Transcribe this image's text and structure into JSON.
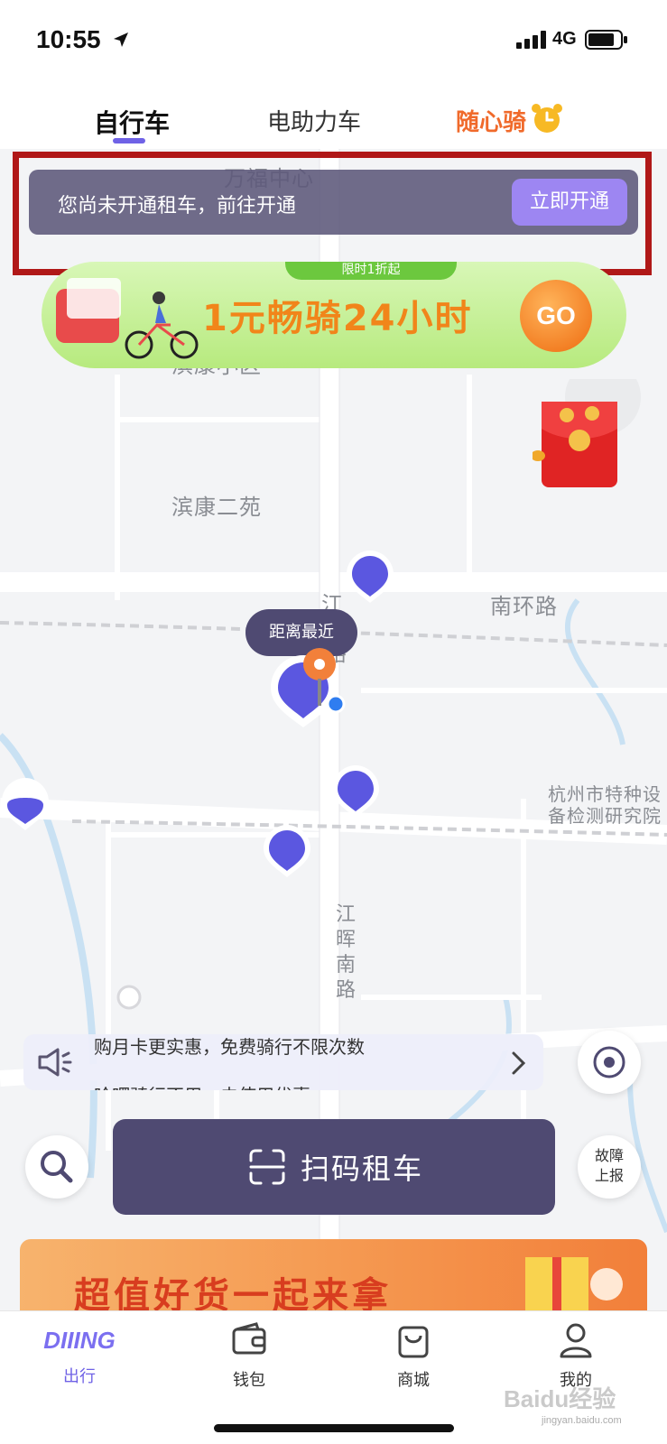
{
  "status_bar": {
    "time": "10:55",
    "network": "4G"
  },
  "tabs": [
    {
      "label": "自行车",
      "active": true
    },
    {
      "label": "电助力车",
      "active": false
    },
    {
      "label": "随心骑",
      "active": false
    }
  ],
  "notice": {
    "text": "您尚未开通租车，前往开通",
    "button": "立即开通"
  },
  "promo": {
    "tag": "限时1折起",
    "text": "1元畅骑24小时",
    "go": "GO"
  },
  "map": {
    "places": [
      "万福中心",
      "滨康小区",
      "滨康二苑",
      "南环路",
      "江",
      "路",
      "杭州市特种设",
      "备检测研究院",
      "江晖南路"
    ],
    "nearest_label": "距离最近"
  },
  "announcement": {
    "line1": "购月卡更实惠，免费骑行不限次数",
    "line2": "哈啰骑行不用，未使用优惠"
  },
  "controls": {
    "scan_label": "扫码租车",
    "report_label": "故障上报"
  },
  "bottom_ad": {
    "text": "超值好货一起来拿"
  },
  "tabbar": [
    {
      "label": "出行",
      "icon": "diing-logo",
      "logo_text": "DIIING",
      "active": true
    },
    {
      "label": "钱包",
      "icon": "wallet-icon",
      "active": false
    },
    {
      "label": "商城",
      "icon": "shop-bag-icon",
      "active": false
    },
    {
      "label": "我的",
      "icon": "user-icon",
      "active": false
    }
  ],
  "watermark": {
    "text": "Baidu经验",
    "sub": "jingyan.baidu.com"
  },
  "colors": {
    "accent": "#6f62e6",
    "dark_button": "#4f4a72",
    "highlight_frame": "#b01818",
    "promo_orange": "#f1851a"
  }
}
